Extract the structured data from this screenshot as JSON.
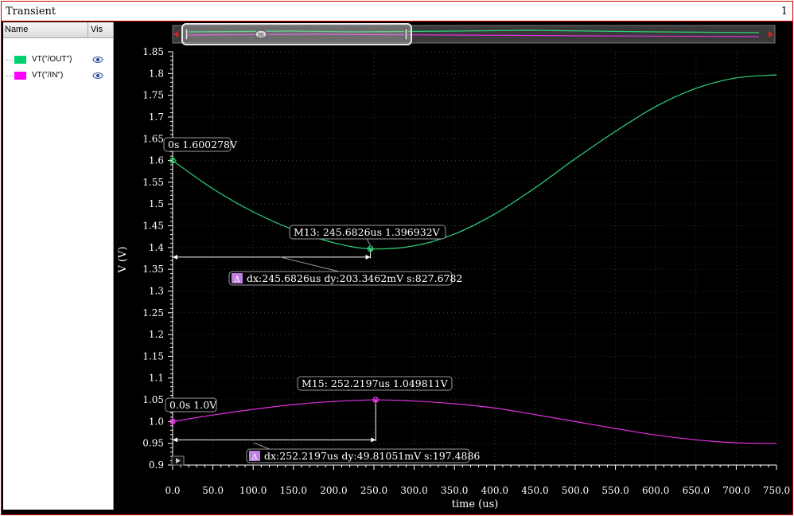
{
  "window": {
    "title": "Transient",
    "number": "1"
  },
  "legend": {
    "header_name": "Name",
    "header_vis": "Vis",
    "items": [
      {
        "label": "VT(\"/OUT\")",
        "color": "#00e060"
      },
      {
        "label": "VT(\"/IN\")",
        "color": "#ff00ff"
      }
    ]
  },
  "colors": {
    "out": "#2ed47a",
    "in": "#e030e0",
    "axis": "#ffffff",
    "grid": "#3a3a3a",
    "marker": "#c080e0"
  },
  "chart_data": {
    "type": "line",
    "xlabel": "time (us)",
    "ylabel": "V (V)",
    "xlim": [
      0,
      750
    ],
    "ylim": [
      0.9,
      1.85
    ],
    "x_ticks": [
      "0.0",
      "50.0",
      "100.0",
      "150.0",
      "200.0",
      "250.0",
      "300.0",
      "350.0",
      "400.0",
      "450.0",
      "500.0",
      "550.0",
      "600.0",
      "650.0",
      "700.0",
      "750.0"
    ],
    "y_ticks": [
      "0.9",
      "0.95",
      "1.0",
      "1.05",
      "1.1",
      "1.15",
      "1.2",
      "1.25",
      "1.3",
      "1.35",
      "1.4",
      "1.45",
      "1.5",
      "1.55",
      "1.6",
      "1.65",
      "1.7",
      "1.75",
      "1.8",
      "1.85"
    ],
    "grid": true,
    "series": [
      {
        "name": "VT(\"/OUT\")",
        "x": [
          0,
          50,
          100,
          150,
          200,
          245.68,
          300,
          350,
          400,
          450,
          500,
          550,
          600,
          650,
          700,
          750
        ],
        "y": [
          1.6,
          1.535,
          1.482,
          1.441,
          1.411,
          1.397,
          1.404,
          1.431,
          1.477,
          1.537,
          1.604,
          1.667,
          1.724,
          1.766,
          1.79,
          1.797
        ]
      },
      {
        "name": "VT(\"/IN\")",
        "x": [
          0,
          50,
          100,
          150,
          200,
          252.22,
          300,
          350,
          400,
          450,
          500,
          550,
          600,
          650,
          700,
          750
        ],
        "y": [
          1.0,
          1.015,
          1.028,
          1.039,
          1.046,
          1.0498,
          1.047,
          1.041,
          1.031,
          1.016,
          1.0,
          0.984,
          0.969,
          0.958,
          0.951,
          0.95
        ]
      }
    ],
    "annotations": {
      "out_start": "0s 1.600278V",
      "m13": "M13: 245.6826us 1.396932V",
      "out_delta": "dx:245.6826us dy:203.3462mV s:827.6782",
      "in_start": "0.0s 1.0V",
      "m15": "M15: 252.2197us 1.049811V",
      "in_delta": "dx:252.2197us dy:49.81051mV s:197.4886",
      "delta_symbol": "Δ",
      "thumb_handle": "m"
    }
  }
}
